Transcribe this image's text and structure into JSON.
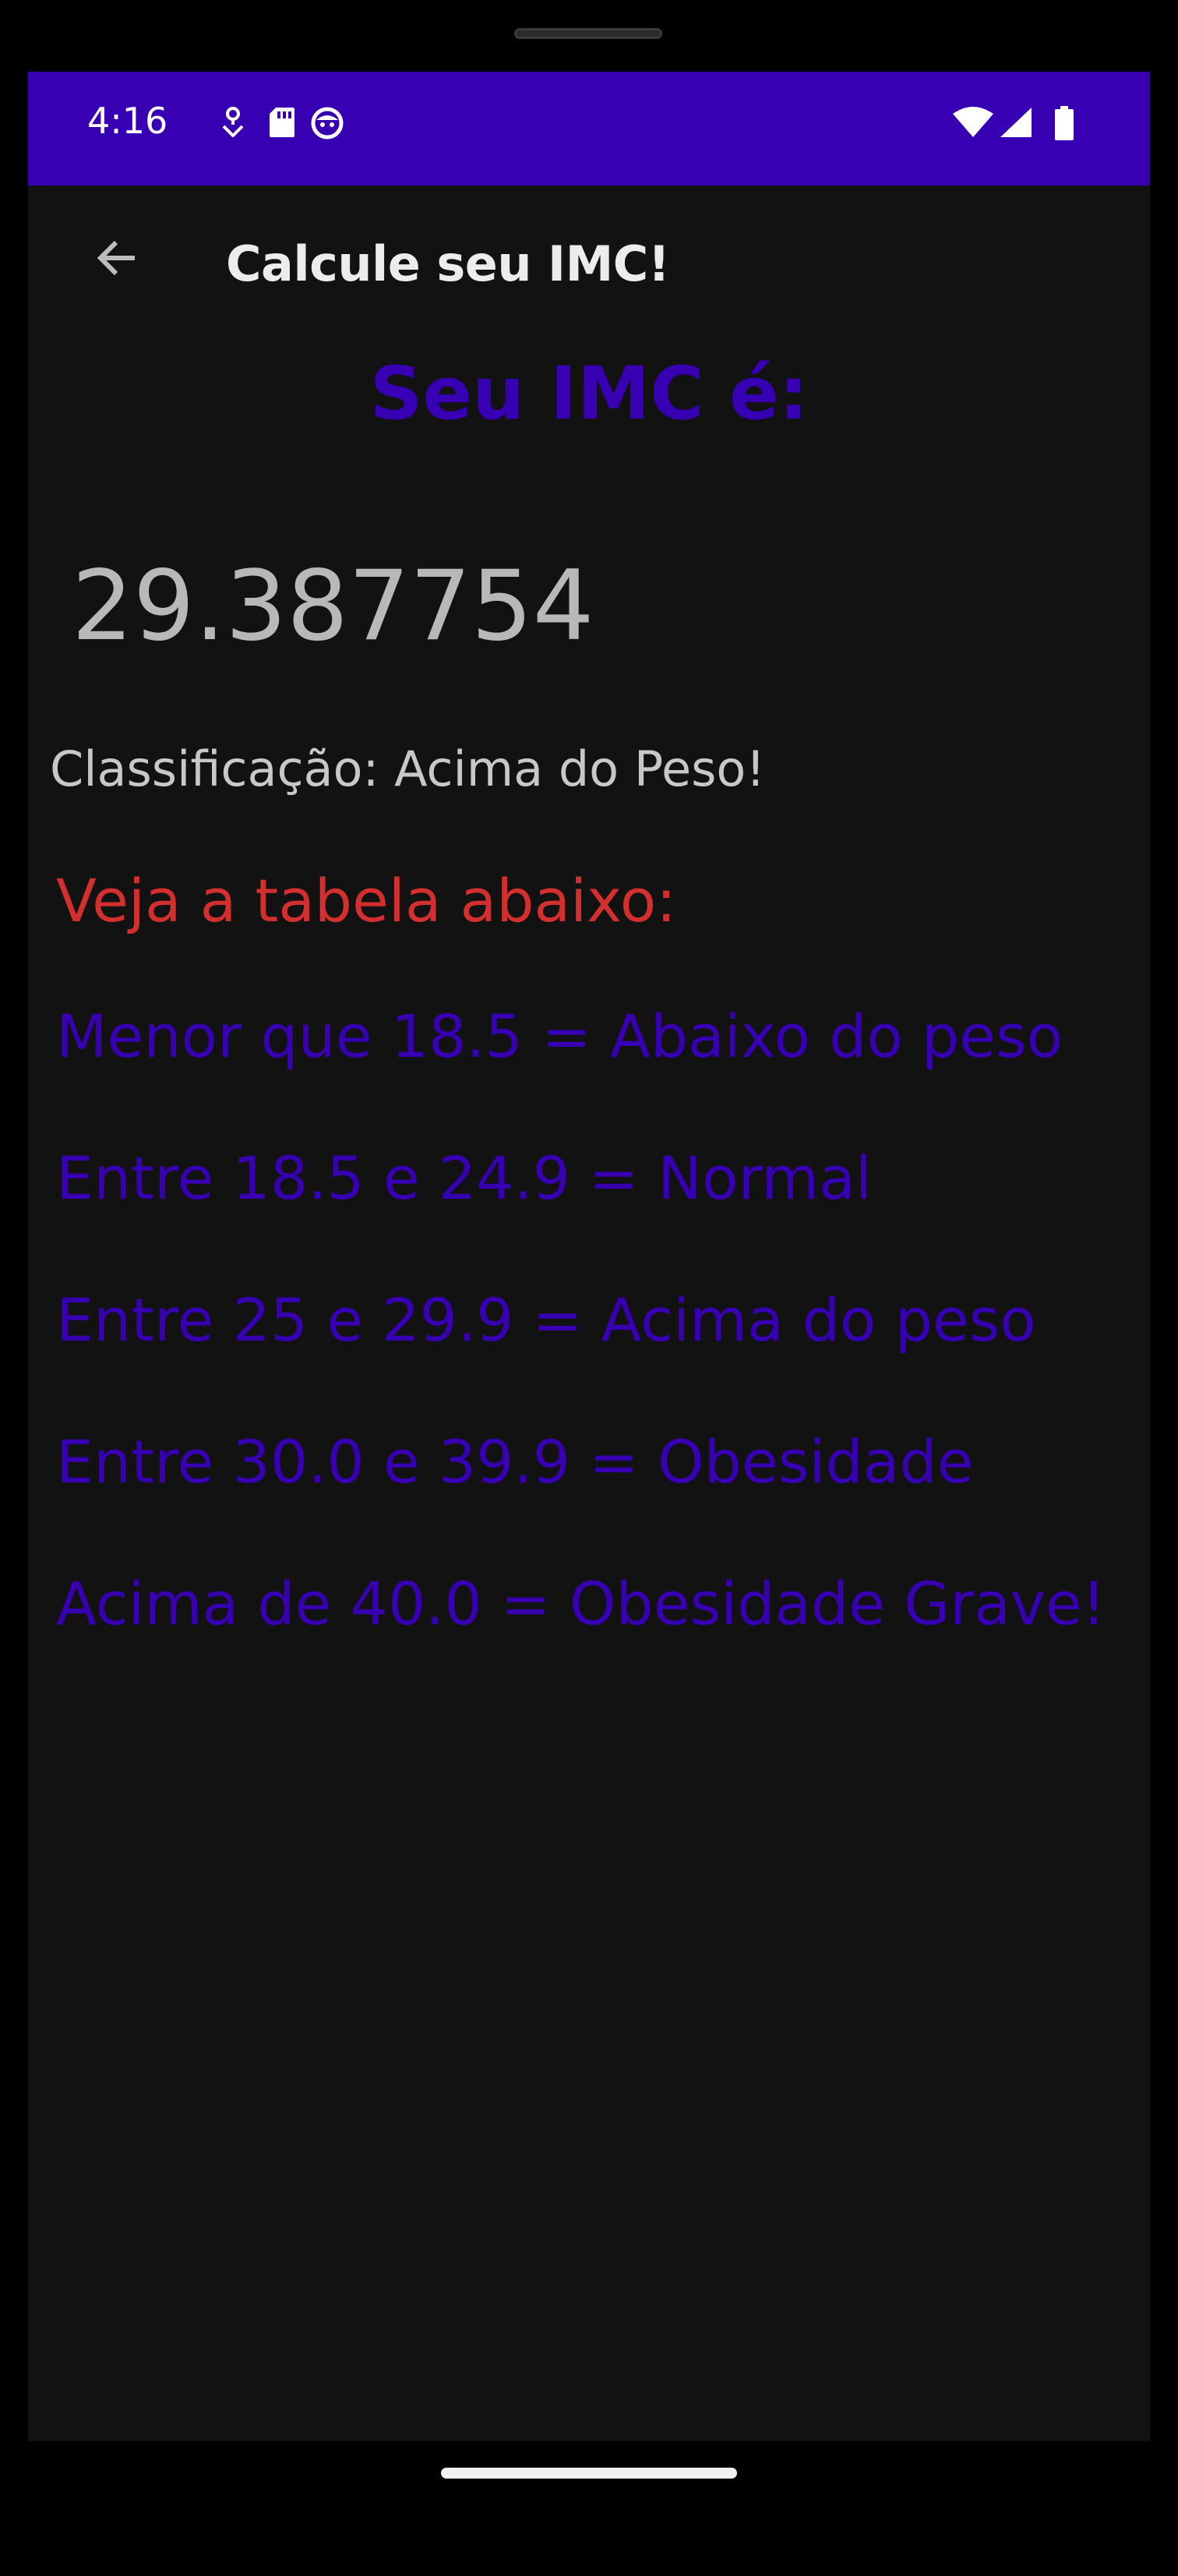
{
  "status_bar": {
    "time": "4:16",
    "background_color": "#3700b3",
    "left_icons": [
      "location-notification-icon",
      "sd-card-icon",
      "face-notification-icon"
    ],
    "right_icons": [
      "wifi-icon",
      "cell-signal-icon",
      "battery-icon"
    ]
  },
  "app_bar": {
    "back_icon": "arrow-back-icon",
    "title": "Calcule seu IMC!"
  },
  "result": {
    "heading": "Seu IMC é:",
    "value": "29.387754",
    "classification": "Classificação: Acima do Peso!"
  },
  "table": {
    "intro": "Veja a tabela abaixo:",
    "ranges": [
      "Menor que 18.5 = Abaixo do peso",
      "Entre 18.5 e 24.9 = Normal",
      "Entre 25 e 29.9 = Acima do peso",
      "Entre 30.0 e 39.9 = Obesidade",
      "Acima de 40.0 = Obesidade Grave!"
    ]
  },
  "colors": {
    "primary": "#3700b3",
    "intro_red": "#d32f2f",
    "background": "#121212"
  }
}
